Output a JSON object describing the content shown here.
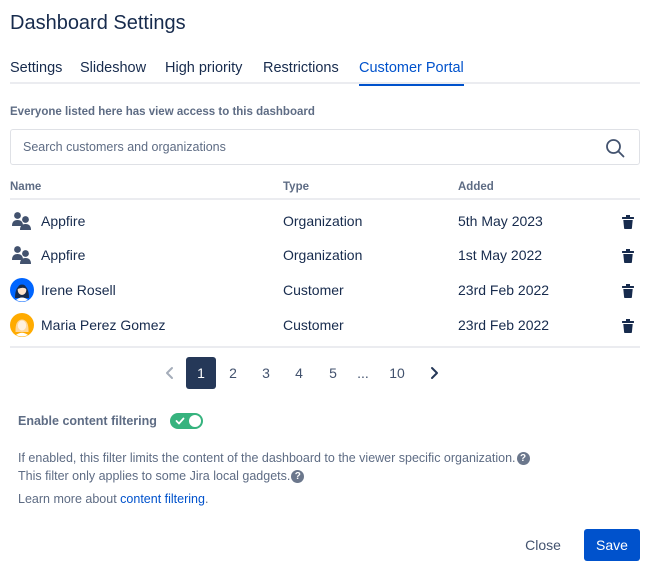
{
  "dialog": {
    "title": "Dashboard Settings"
  },
  "tabs": [
    {
      "label": "Settings"
    },
    {
      "label": "Slideshow"
    },
    {
      "label": "High priority"
    },
    {
      "label": "Restrictions"
    },
    {
      "label": "Customer Portal",
      "active": true
    }
  ],
  "access_note": "Everyone listed here has view access to this dashboard",
  "search": {
    "placeholder": "Search customers and organizations",
    "value": "",
    "icon": "search-icon"
  },
  "table": {
    "columns": {
      "name": "Name",
      "type": "Type",
      "added": "Added"
    },
    "rows": [
      {
        "name": "Appfire",
        "type": "Organization",
        "added": "5th May 2023",
        "avatar": "organization-icon"
      },
      {
        "name": "Appfire",
        "type": "Organization",
        "added": "1st May 2022",
        "avatar": "organization-icon"
      },
      {
        "name": "Irene Rosell",
        "type": "Customer",
        "added": "23rd Feb 2022",
        "avatar": "user-avatar-blue"
      },
      {
        "name": "Maria Perez Gomez",
        "type": "Customer",
        "added": "23rd Feb 2022",
        "avatar": "user-avatar-orange"
      }
    ],
    "row_action_icon": "trash-icon"
  },
  "pagination": {
    "pages": [
      "1",
      "2",
      "3",
      "4",
      "5",
      "...",
      "10"
    ],
    "current": "1"
  },
  "content_filtering": {
    "label": "Enable content filtering",
    "enabled": true,
    "description_1": "If enabled, this filter limits the content of the dashboard to the viewer specific organization.",
    "description_2": "This filter only applies to some Jira local gadgets.",
    "help_glyph": "?",
    "learn_more_prefix": "Learn more about",
    "learn_more_link": "content filtering",
    "learn_more_suffix": "."
  },
  "footer": {
    "close_label": "Close",
    "save_label": "Save"
  },
  "colors": {
    "primary": "#0052cc",
    "text": "#172b4d",
    "subtle_text": "#5e6c84",
    "toggle_on": "#36b37e",
    "pager_current": "#253858"
  }
}
